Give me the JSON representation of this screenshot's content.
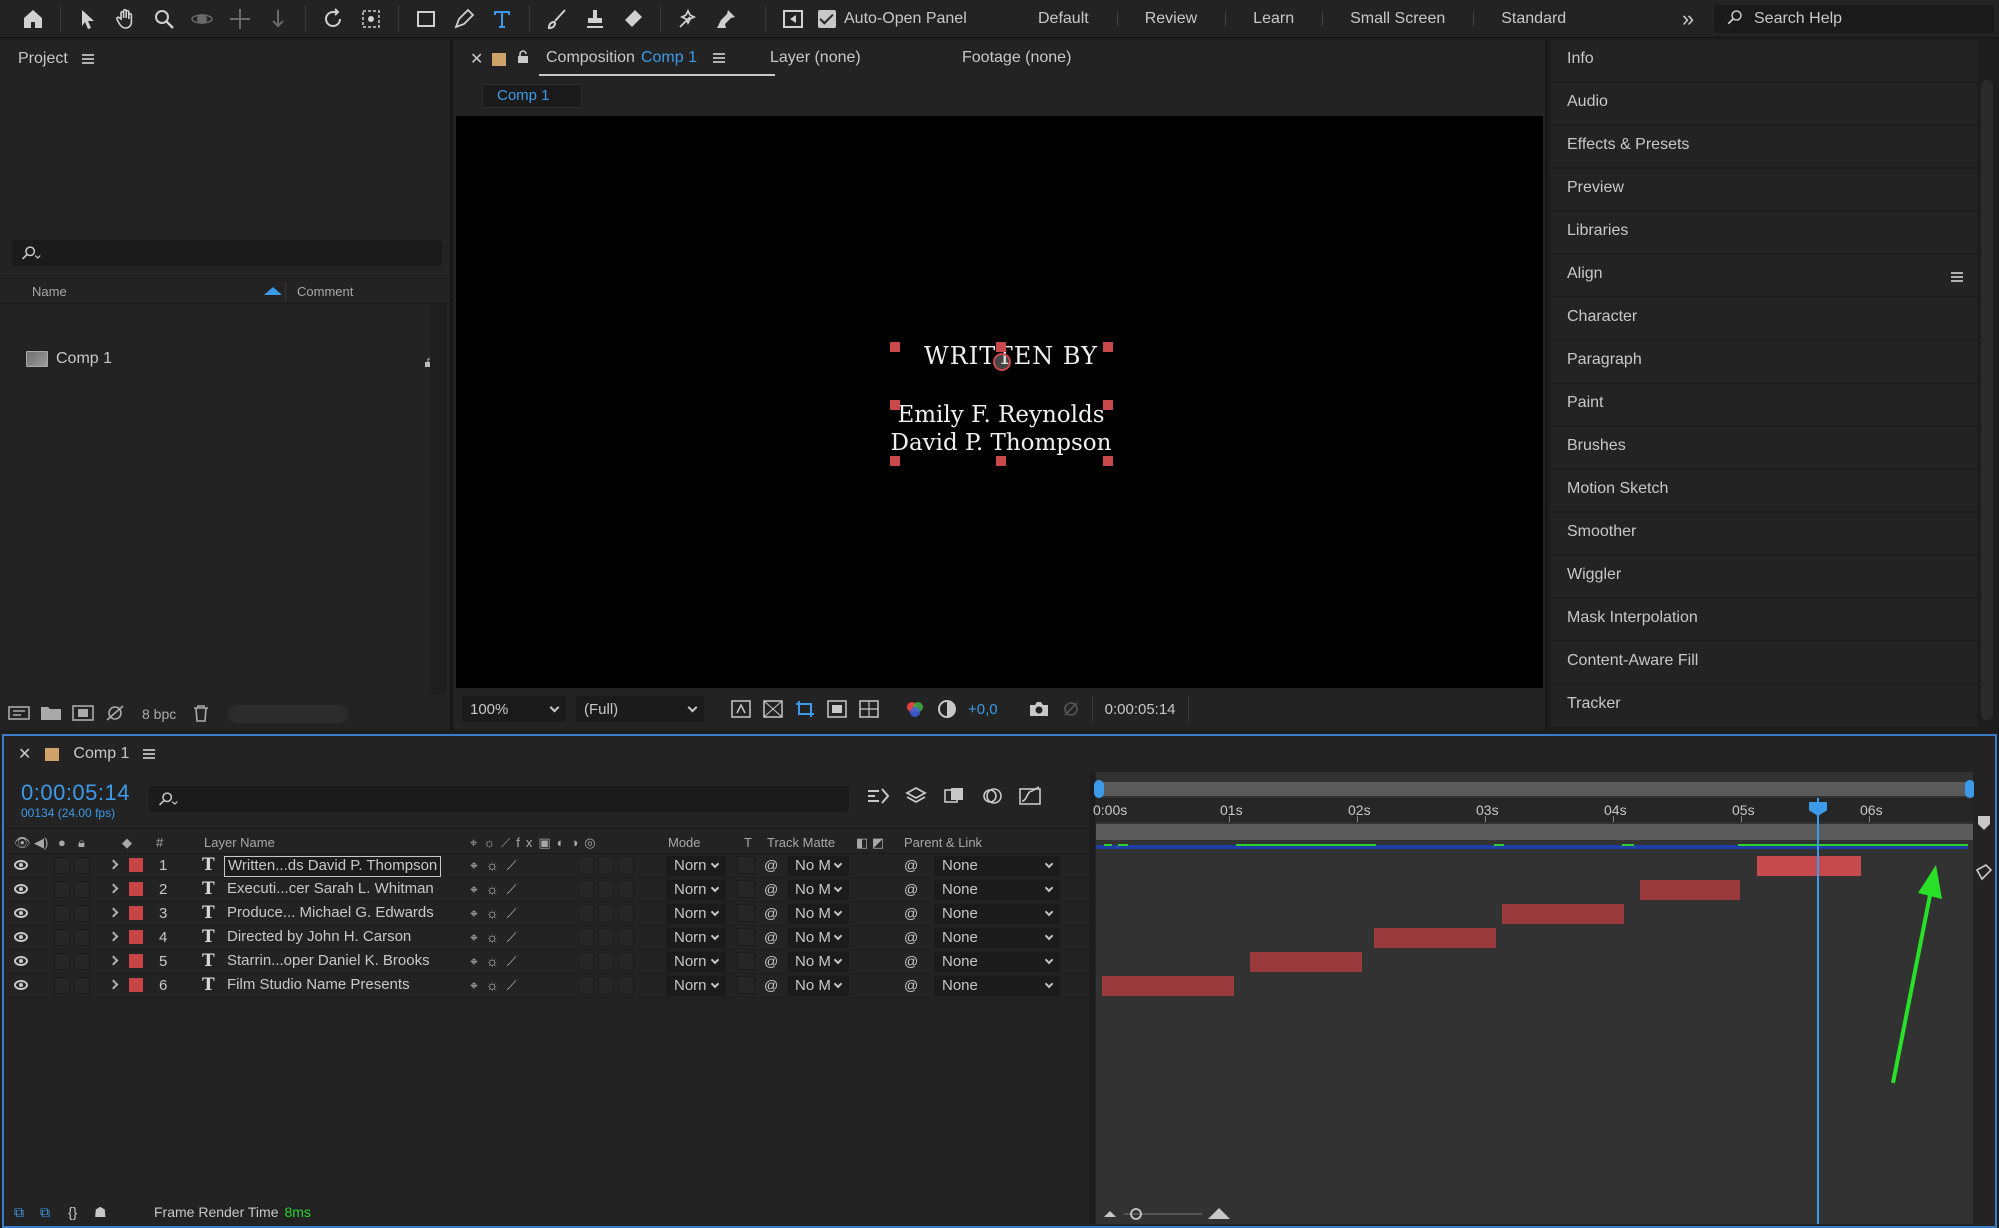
{
  "toolbar": {
    "auto_open_panel": "Auto-Open Panel",
    "workspaces": [
      "Default",
      "Review",
      "Learn",
      "Small Screen",
      "Standard"
    ],
    "more": "»",
    "search_help": "Search Help"
  },
  "project": {
    "title": "Project",
    "col_name": "Name",
    "col_comment": "Comment",
    "item": "Comp 1",
    "bpc": "8 bpc"
  },
  "viewer": {
    "tab_composition": "Composition",
    "tab_composition_name": "Comp 1",
    "tab_layer": "Layer (none)",
    "tab_footage": "Footage (none)",
    "sub_tab": "Comp 1",
    "canvas_line1": "WRITTEN BY",
    "canvas_line2": "Emily F. Reynolds",
    "canvas_line3": "David P. Thompson",
    "zoom": "100%",
    "resolution": "(Full)",
    "exposure": "+0,0",
    "timecode": "0:00:05:14"
  },
  "right_panel": {
    "items": [
      "Info",
      "Audio",
      "Effects & Presets",
      "Preview",
      "Libraries",
      "Align",
      "Character",
      "Paragraph",
      "Paint",
      "Brushes",
      "Motion Sketch",
      "Smoother",
      "Wiggler",
      "Mask Interpolation",
      "Content-Aware Fill",
      "Tracker"
    ]
  },
  "timeline": {
    "tab": "Comp 1",
    "timecode": "0:00:05:14",
    "frames": "00134 (24.00 fps)",
    "headers": {
      "num": "#",
      "layer_name": "Layer Name",
      "mode": "Mode",
      "t": "T",
      "track_matte": "Track Matte",
      "parent": "Parent & Link"
    },
    "ruler": [
      "0:00s",
      "01s",
      "02s",
      "03s",
      "04s",
      "05s",
      "06s"
    ],
    "layers": [
      {
        "num": "1",
        "name": "Written...ds David P. Thompson",
        "mode": "Norn",
        "matte": "No M",
        "parent": "None"
      },
      {
        "num": "2",
        "name": "Executi...cer  Sarah L. Whitman",
        "mode": "Norn",
        "matte": "No M",
        "parent": "None"
      },
      {
        "num": "3",
        "name": "Produce...  Michael G. Edwards",
        "mode": "Norn",
        "matte": "No M",
        "parent": "None"
      },
      {
        "num": "4",
        "name": "Directed by  John H. Carson",
        "mode": "Norn",
        "matte": "No M",
        "parent": "None"
      },
      {
        "num": "5",
        "name": "Starrin...oper Daniel K. Brooks",
        "mode": "Norn",
        "matte": "No M",
        "parent": "None"
      },
      {
        "num": "6",
        "name": "Film Studio Name Presents",
        "mode": "Norn",
        "matte": "No M",
        "parent": "None"
      }
    ],
    "frame_render_label": "Frame Render Time",
    "frame_render_value": "8ms"
  },
  "colors": {
    "accent": "#3d9ae8",
    "label_red": "#c94446",
    "layer_bar": "#9b3a3d",
    "annotation_arrow": "#28e028"
  }
}
